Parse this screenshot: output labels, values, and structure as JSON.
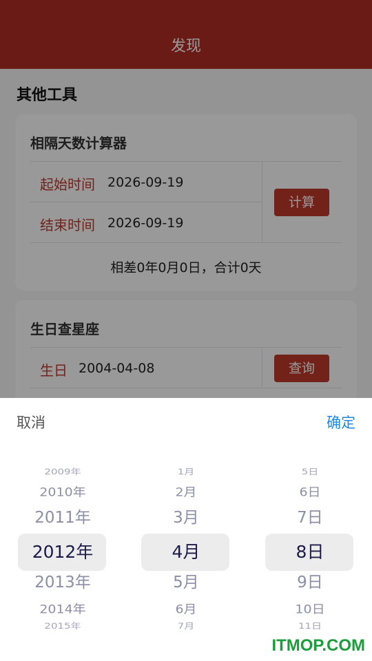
{
  "header": {
    "title": "发现"
  },
  "main": {
    "section_title": "其他工具",
    "days_calc": {
      "title": "相隔天数计算器",
      "start_label": "起始时间",
      "start_value": "2026-09-19",
      "end_label": "结束时间",
      "end_value": "2026-09-19",
      "button": "计算",
      "result": "相差0年0月0日，合计0天"
    },
    "zodiac": {
      "title": "生日查星座",
      "birthday_label": "生日",
      "birthday_value": "2004-04-08",
      "button": "查询"
    }
  },
  "picker": {
    "cancel": "取消",
    "confirm": "确定",
    "years": [
      "2009年",
      "2010年",
      "2011年",
      "2012年",
      "2013年",
      "2014年",
      "2015年"
    ],
    "months": [
      "1月",
      "2月",
      "3月",
      "4月",
      "5月",
      "6月",
      "7月"
    ],
    "days": [
      "5日",
      "6日",
      "7日",
      "8日",
      "9日",
      "10日",
      "11日"
    ],
    "selected": {
      "year": "2012年",
      "month": "4月",
      "day": "8日"
    }
  },
  "colors": {
    "header": "#b22d23",
    "accent": "#c0392b",
    "confirm": "#1e88e5"
  },
  "watermark": "ITMOP.COM"
}
